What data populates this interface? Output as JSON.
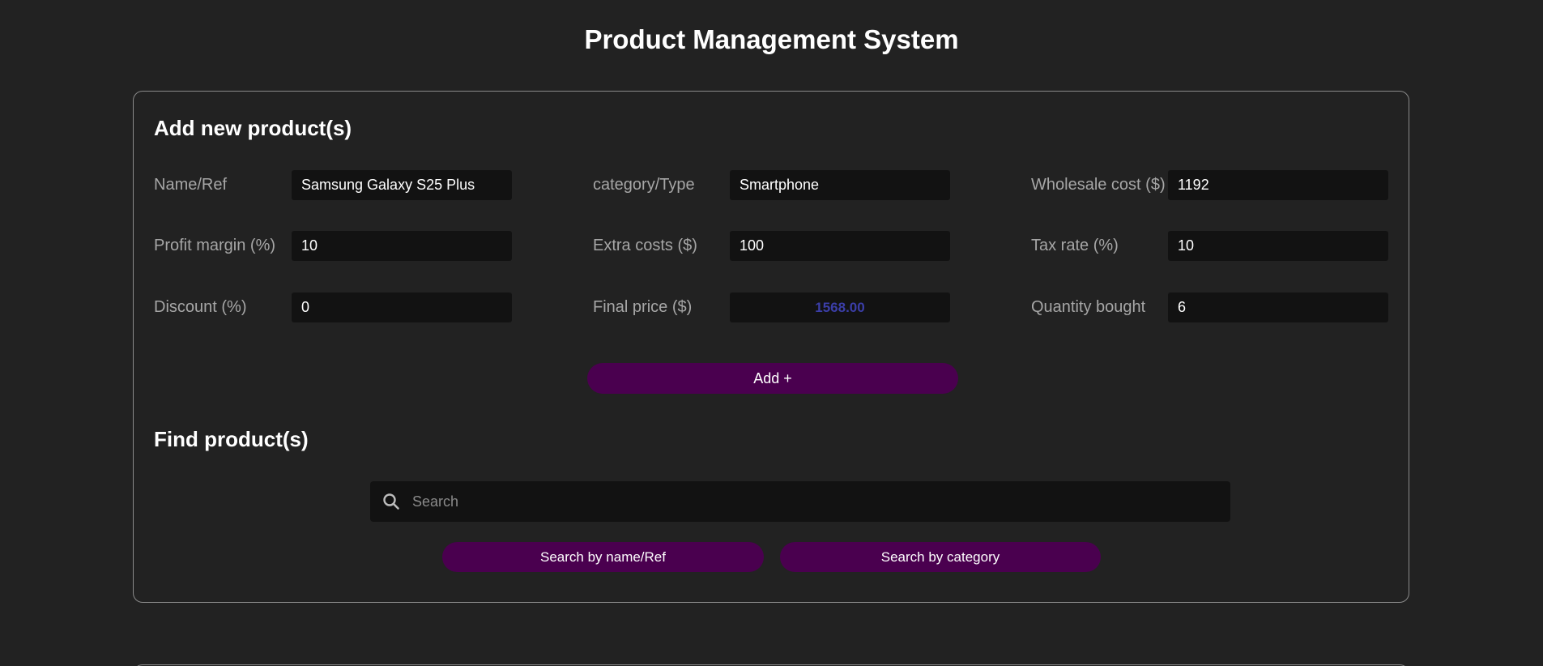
{
  "page": {
    "title": "Product Management System"
  },
  "add_section": {
    "heading": "Add new product(s)",
    "fields": {
      "name": {
        "label": "Name/Ref",
        "value": "Samsung Galaxy S25 Plus"
      },
      "category": {
        "label": "category/Type",
        "value": "Smartphone"
      },
      "wholesale": {
        "label": "Wholesale cost ($)",
        "value": "1192"
      },
      "margin": {
        "label": "Profit margin (%)",
        "value": "10"
      },
      "extra": {
        "label": "Extra costs ($)",
        "value": "100"
      },
      "tax": {
        "label": "Tax rate (%)",
        "value": "10"
      },
      "discount": {
        "label": "Discount (%)",
        "value": "0"
      },
      "final": {
        "label": "Final price ($)",
        "value": "1568.00"
      },
      "quantity": {
        "label": "Quantity bought",
        "value": "6"
      }
    },
    "add_button": "Add +"
  },
  "find_section": {
    "heading": "Find product(s)",
    "search": {
      "placeholder": "Search",
      "value": ""
    },
    "by_name_button": "Search by name/Ref",
    "by_category_button": "Search by category"
  },
  "colors": {
    "background": "#222222",
    "input_background": "#121212",
    "accent_purple": "#4a004f",
    "final_price_text": "#3b3ea8",
    "label_text": "#a6a6a6",
    "panel_border": "#8a8a8a"
  },
  "icons": {
    "search": "magnifier-icon"
  }
}
